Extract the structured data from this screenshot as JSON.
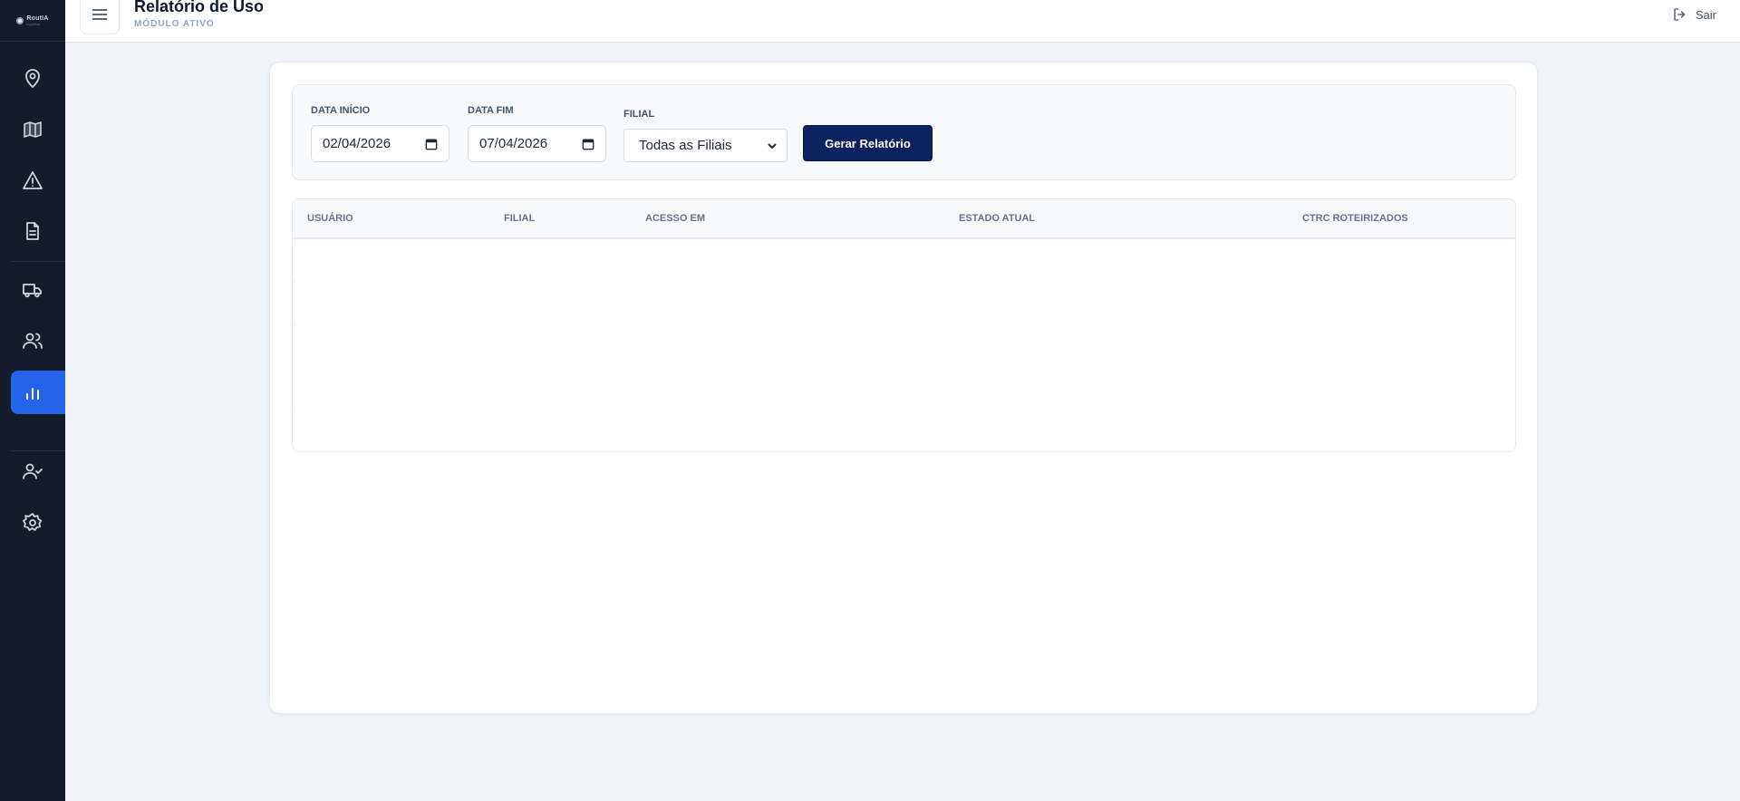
{
  "app": {
    "logo_text": "RoutIA",
    "logo_sub": "logística"
  },
  "sidebar": {
    "items": [
      {
        "name": "location",
        "icon": "map-pin-icon",
        "active": false
      },
      {
        "name": "map",
        "icon": "map-book-icon",
        "active": false
      },
      {
        "name": "alerts",
        "icon": "alert-triangle-icon",
        "active": false
      },
      {
        "name": "documents",
        "icon": "file-text-icon",
        "active": false
      },
      {
        "name": "fleet",
        "icon": "truck-icon",
        "active": false
      },
      {
        "name": "users",
        "icon": "users-icon",
        "active": false
      },
      {
        "name": "reports",
        "icon": "bar-chart-icon",
        "active": true
      },
      {
        "name": "user-permissions",
        "icon": "user-check-icon",
        "active": false
      },
      {
        "name": "settings",
        "icon": "gear-icon",
        "active": false
      }
    ],
    "active_color": "#2563eb"
  },
  "header": {
    "title": "Relatório de Uso",
    "subtitle": "MÓDULO ATIVO",
    "logout_label": "Sair"
  },
  "filters": {
    "start_label": "DATA INÍCIO",
    "start_value": "02/04/2026",
    "end_label": "DATA FIM",
    "end_value": "07/04/2026",
    "branch_label": "FILIAL",
    "branch_value": "Todas as Filiais",
    "generate_label": "Gerar Relatório",
    "button_color": "#0d2260"
  },
  "table": {
    "columns": [
      "USUÁRIO",
      "FILIAL",
      "ACESSO EM",
      "ESTADO ATUAL",
      "CTRC ROTEIRIZADOS"
    ],
    "rows": []
  }
}
